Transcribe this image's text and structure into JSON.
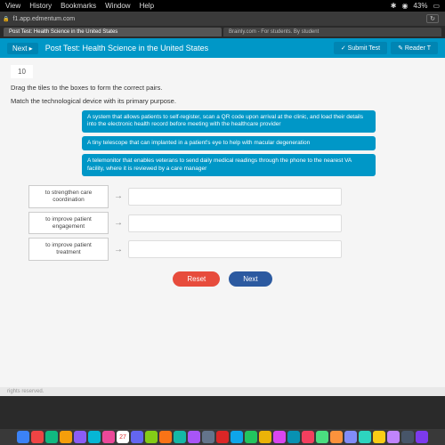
{
  "menubar": {
    "items": [
      "View",
      "History",
      "Bookmarks",
      "Window",
      "Help"
    ],
    "battery": "43%"
  },
  "browser": {
    "url": "f1.app.edmentum.com",
    "tabs": [
      {
        "label": "Post Test: Health Science in the United States"
      },
      {
        "label": "Brainly.com - For students. By student"
      }
    ]
  },
  "toolbar": {
    "nav": "Next ▸",
    "title": "Post Test: Health Science in the United States",
    "submit": "✓ Submit Test",
    "reader": "✎ Reader T"
  },
  "question": {
    "number": "10",
    "instr1": "Drag the tiles to the boxes to form the correct pairs.",
    "instr2": "Match the technological device with its primary purpose.",
    "tiles": [
      "A system that allows patients to self-register, scan a QR code upon arrival at the clinic, and load their details into the electronic health record before meeting with the healthcare provider",
      "A tiny telescope that can implanted in a patient's eye to help with macular degeneration",
      "A telemonitor that enables veterans to send daily medical readings through the phone to the nearest VA facility, where it is reviewed by a care manager"
    ],
    "labels": [
      "to strengthen care coordination",
      "to improve patient engagement",
      "to improve patient treatment"
    ],
    "reset": "Reset",
    "next": "Next"
  },
  "footer": "rights reserved.",
  "dock": {
    "badge": "27",
    "colors": [
      "#3b82f6",
      "#ef4444",
      "#10b981",
      "#f59e0b",
      "#8b5cf6",
      "#06b6d4",
      "#ec4899",
      "#fff",
      "#6366f1",
      "#84cc16",
      "#f97316",
      "#14b8a6",
      "#a855f7",
      "#64748b",
      "#dc2626",
      "#0ea5e9",
      "#22c55e",
      "#eab308",
      "#d946ef",
      "#0891b2",
      "#f43f5e",
      "#4ade80",
      "#fb923c",
      "#818cf8",
      "#2dd4bf",
      "#facc15",
      "#c084fc",
      "#475569",
      "#7c3aed"
    ]
  }
}
